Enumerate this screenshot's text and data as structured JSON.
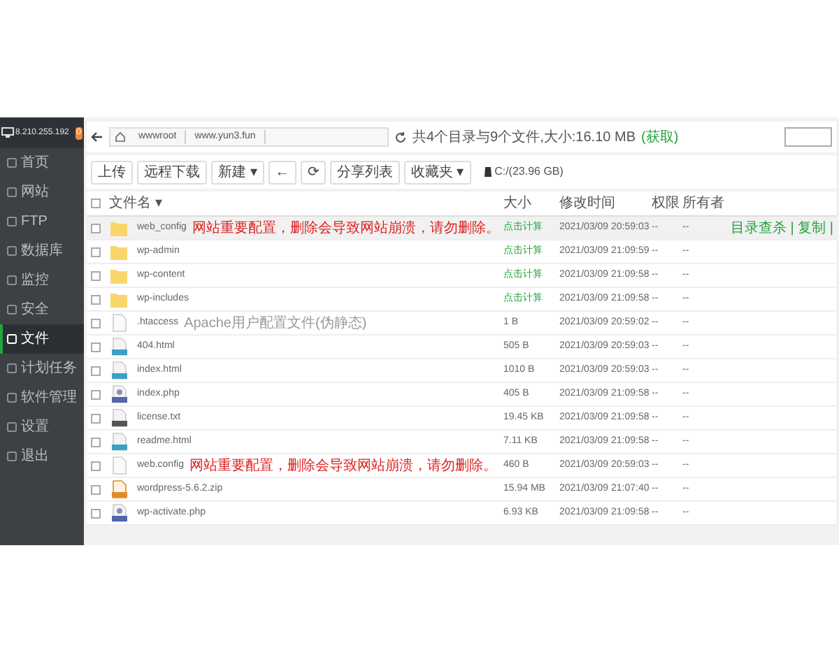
{
  "sidebar": {
    "server": "8.210.255.192",
    "badge": "0",
    "items": [
      {
        "label": "首页",
        "selected": false
      },
      {
        "label": "网站",
        "selected": false
      },
      {
        "label": "FTP",
        "selected": false
      },
      {
        "label": "数据库",
        "selected": false
      },
      {
        "label": "监控",
        "selected": false
      },
      {
        "label": "安全",
        "selected": false
      },
      {
        "label": "文件",
        "selected": true
      },
      {
        "label": "计划任务",
        "selected": false
      },
      {
        "label": "软件管理",
        "selected": false
      },
      {
        "label": "设置",
        "selected": false
      },
      {
        "label": "退出",
        "selected": false
      }
    ]
  },
  "path_bar": {
    "crumbs": [
      "wwwroot",
      "www.yun3.fun"
    ],
    "summary": "共4个目录与9个文件,大小:16.10 MB",
    "summary_link": "(获取)"
  },
  "toolbar": {
    "buttons": [
      {
        "label": "上传",
        "kind": "text"
      },
      {
        "label": "远程下载",
        "kind": "text"
      },
      {
        "label": "新建",
        "kind": "dropdown",
        "caret": "▾"
      },
      {
        "label": "←",
        "kind": "text"
      },
      {
        "label": "⟳",
        "kind": "text"
      },
      {
        "label": "分享列表",
        "kind": "text"
      },
      {
        "label": "收藏夹",
        "kind": "dropdown",
        "caret": "▾"
      }
    ],
    "disk": "C:/(23.96 GB)"
  },
  "table": {
    "select_all": {
      "checked": false
    },
    "sort_caret": "▾",
    "columns": [
      "文件名",
      "大小",
      "修改时间",
      "权限",
      "所有者"
    ],
    "rows": [
      {
        "kind": "folder",
        "name": "web_config",
        "note": "网站重要配置，删除会导致网站崩溃，请勿删除。",
        "warning": true,
        "size": "点击计算",
        "time": "2021/03/09 20:59:03",
        "perm": "--",
        "owner": "--",
        "actions": "目录查杀 | 复制 |",
        "selected": true,
        "checked": false
      },
      {
        "kind": "folder",
        "name": "wp-admin",
        "size": "点击计算",
        "time": "2021/03/09 21:09:59",
        "perm": "--",
        "owner": "--",
        "selected": false,
        "checked": false
      },
      {
        "kind": "folder",
        "name": "wp-content",
        "size": "点击计算",
        "time": "2021/03/09 21:09:58",
        "perm": "--",
        "owner": "--",
        "selected": false,
        "checked": false
      },
      {
        "kind": "folder",
        "name": "wp-includes",
        "size": "点击计算",
        "time": "2021/03/09 21:09:58",
        "perm": "--",
        "owner": "--",
        "selected": false,
        "checked": false
      },
      {
        "kind": "file",
        "name": ".htaccess",
        "note": "Apache用户配置文件(伪静态)",
        "warning": false,
        "size": "1 B",
        "time": "2021/03/09 20:59:02",
        "perm": "--",
        "owner": "--",
        "selected": false,
        "checked": false
      },
      {
        "kind": "html",
        "name": "404.html",
        "size": "505 B",
        "time": "2021/03/09 20:59:03",
        "perm": "--",
        "owner": "--",
        "selected": false,
        "checked": false
      },
      {
        "kind": "html",
        "name": "index.html",
        "size": "1010 B",
        "time": "2021/03/09 20:59:03",
        "perm": "--",
        "owner": "--",
        "selected": false,
        "checked": false
      },
      {
        "kind": "php",
        "name": "index.php",
        "size": "405 B",
        "time": "2021/03/09 21:09:58",
        "perm": "--",
        "owner": "--",
        "selected": false,
        "checked": false
      },
      {
        "kind": "txt",
        "name": "license.txt",
        "size": "19.45 KB",
        "time": "2021/03/09 21:09:58",
        "perm": "--",
        "owner": "--",
        "selected": false,
        "checked": false
      },
      {
        "kind": "html",
        "name": "readme.html",
        "size": "7.11 KB",
        "time": "2021/03/09 21:09:58",
        "perm": "--",
        "owner": "--",
        "selected": false,
        "checked": false
      },
      {
        "kind": "file",
        "name": "web.config",
        "note": "网站重要配置，删除会导致网站崩溃，请勿删除。",
        "warning": true,
        "size": "460 B",
        "time": "2021/03/09 20:59:03",
        "perm": "--",
        "owner": "--",
        "selected": false,
        "checked": false
      },
      {
        "kind": "zip",
        "name": "wordpress-5.6.2.zip",
        "size": "15.94 MB",
        "time": "2021/03/09 21:07:40",
        "perm": "--",
        "owner": "--",
        "selected": false,
        "checked": false
      },
      {
        "kind": "php",
        "name": "wp-activate.php",
        "size": "6.93 KB",
        "time": "2021/03/09 21:09:58",
        "perm": "--",
        "owner": "--",
        "selected": false,
        "checked": false
      }
    ]
  }
}
